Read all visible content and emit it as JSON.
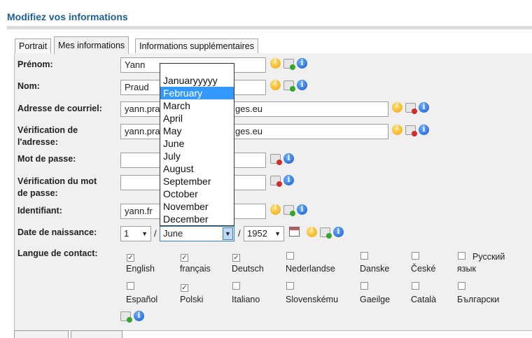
{
  "page_title": "Modifiez vos informations",
  "tabs": [
    {
      "label": "Portrait"
    },
    {
      "label": "Mes informations"
    },
    {
      "label": "Informations supplémentaires"
    }
  ],
  "fields": {
    "prenom": {
      "label": "Prénom:",
      "value": "Yann"
    },
    "nom": {
      "label": "Nom:",
      "value": "Praud"
    },
    "email": {
      "label": "Adresse de courriel:",
      "value_left": "yann.pra",
      "value_right": "ges.eu"
    },
    "email_verify": {
      "label_line1": "Vérification de",
      "label_line2": "l'adresse:",
      "value_left": "yann.pra",
      "value_right": "ges.eu"
    },
    "password": {
      "label": "Mot de passe:"
    },
    "password_verify": {
      "label_line1": "Vérification du mot",
      "label_line2": "de passe:"
    },
    "identifiant": {
      "label": "Identifiant:",
      "value": "yann.fr"
    },
    "birthdate": {
      "label": "Date de naissance:",
      "day": "1",
      "month": "June",
      "year": "1952",
      "separator": "/"
    },
    "langue": {
      "label": "Langue de contact:"
    }
  },
  "month_dropdown": {
    "options": [
      "Januaryyyyy",
      "February",
      "March",
      "April",
      "May",
      "June",
      "July",
      "August",
      "September",
      "October",
      "November",
      "December"
    ],
    "highlighted": "February"
  },
  "languages": [
    {
      "name": "English",
      "checked": true
    },
    {
      "name": "français",
      "checked": true
    },
    {
      "name": "Deutsch",
      "checked": true
    },
    {
      "name": "Nederlandse",
      "checked": false
    },
    {
      "name": "Danske",
      "checked": false
    },
    {
      "name": "České",
      "checked": false
    },
    {
      "name_line1": "Русский",
      "name_line2": "язык",
      "checked": false
    },
    {
      "name": "Español",
      "checked": false
    },
    {
      "name": "Polski",
      "checked": true
    },
    {
      "name": "Italiano",
      "checked": false
    },
    {
      "name": "Slovenskému",
      "checked": false
    },
    {
      "name": "Gaeilge",
      "checked": false
    },
    {
      "name": "Català",
      "checked": false
    },
    {
      "name": "Български",
      "checked": false
    }
  ],
  "icons": {
    "warning": "warning-icon",
    "sync": "sync-visibility-icon",
    "blocked": "blocked-visibility-icon",
    "info": "info-icon",
    "calendar": "calendar-icon"
  },
  "colors": {
    "title": "#1f5f94",
    "highlight": "#3399ff",
    "panel": "#f0f0f0"
  }
}
